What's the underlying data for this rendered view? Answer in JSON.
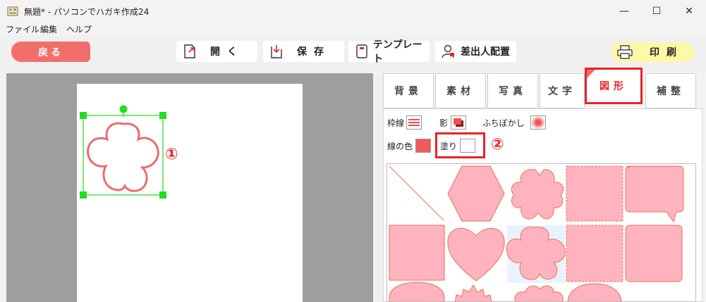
{
  "window": {
    "title": "無題* - パソコンでハガキ作成24",
    "minimize_glyph": "—",
    "maximize_glyph": "☐",
    "close_glyph": "✕"
  },
  "menu": [
    "ファイル",
    "編集",
    "ヘルプ"
  ],
  "toolbar": {
    "back_label": "戻る",
    "open_label": "開く",
    "save_label": "保存",
    "template_label": "テンプレート",
    "mail_merge_label": "差出人配置",
    "print_label": "印刷"
  },
  "tabs": [
    {
      "label": "背景"
    },
    {
      "label": "素材"
    },
    {
      "label": "写真"
    },
    {
      "label": "文字"
    },
    {
      "label": "図形",
      "active": true
    },
    {
      "label": "補整"
    }
  ],
  "properties": {
    "border_label": "枠線",
    "shadow_label": "影",
    "blur_label": "ふちぼかし",
    "line_color_label": "線の色",
    "fill_label": "塗り"
  },
  "annotations": {
    "one": "①",
    "two": "②"
  },
  "colors": {
    "accent_red": "#e8232a",
    "back_button": "#f26e6c",
    "print_button": "#fff8a8",
    "shape_fill": "#ffb3bf",
    "shape_stroke": "#e8724f",
    "selection_handle": "#22dd22"
  },
  "shapes": [
    "line-diagonal",
    "hexagon",
    "sakura",
    "stamp",
    "speech-bubble",
    "square",
    "heart",
    "plum-flower",
    "stamp-square",
    "rounded-square",
    "circle-half",
    "starburst",
    "plum-flower-2",
    "circle"
  ]
}
